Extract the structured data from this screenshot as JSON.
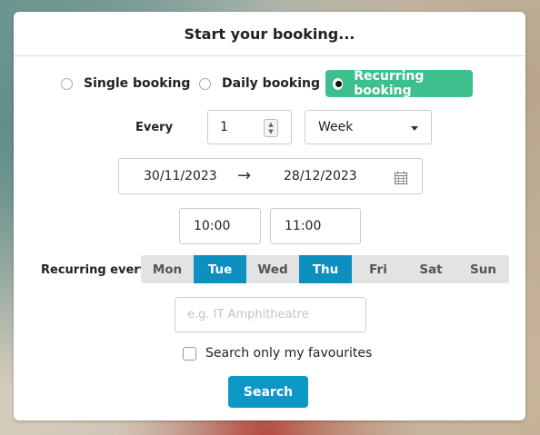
{
  "title": "Start your booking...",
  "booking_types": [
    {
      "label": "Single booking",
      "selected": false
    },
    {
      "label": "Daily booking",
      "selected": false
    },
    {
      "label": "Recurring booking",
      "selected": true
    }
  ],
  "every": {
    "label": "Every",
    "value": "1",
    "unit": "Week"
  },
  "date_range": {
    "start": "30/11/2023",
    "arrow": "→",
    "end": "28/12/2023"
  },
  "time": {
    "start": "10:00",
    "end": "11:00"
  },
  "recurring": {
    "label": "Recurring every",
    "days": [
      {
        "label": "Mon",
        "selected": false
      },
      {
        "label": "Tue",
        "selected": true
      },
      {
        "label": "Wed",
        "selected": false
      },
      {
        "label": "Thu",
        "selected": true
      },
      {
        "label": "Fri",
        "selected": false
      },
      {
        "label": "Sat",
        "selected": false
      },
      {
        "label": "Sun",
        "selected": false
      }
    ]
  },
  "location": {
    "placeholder": "e.g. IT Amphitheatre",
    "value": ""
  },
  "favourites": {
    "label": "Search only my favourites",
    "checked": false
  },
  "search_button": "Search",
  "colors": {
    "accent_green": "#3dbf8e",
    "accent_blue": "#0d8fbf",
    "search_blue": "#0d97c6"
  },
  "icons": {
    "calendar": "calendar-icon",
    "stepper": "number-stepper-icon",
    "dropdown": "chevron-down-icon"
  }
}
